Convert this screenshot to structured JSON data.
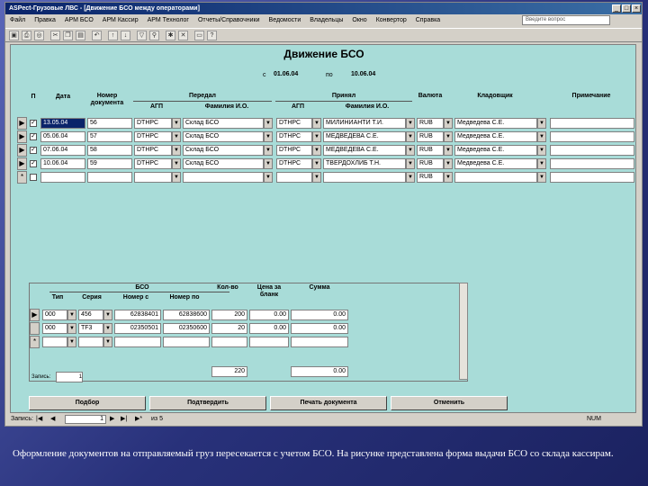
{
  "window": {
    "title": "ASPect-Грузовые ЛВС - [Движение БСО между операторами]",
    "minimize": "_",
    "maximize": "□",
    "close": "×"
  },
  "menu": [
    "Файл",
    "Правка",
    "АРМ БСО",
    "АРМ Кассир",
    "АРМ Технолог",
    "Отчеты/Справочники",
    "Ведомости",
    "Владельцы",
    "Окно",
    "Конвертор",
    "Справка"
  ],
  "help_placeholder": "Введите вопрос",
  "toolbar": {
    "icons": [
      "save",
      "print",
      "preview",
      "cut",
      "copy",
      "paste",
      "undo",
      "sort-asc",
      "sort-desc",
      "filter",
      "find",
      "new",
      "delete",
      "close",
      "help"
    ]
  },
  "form": {
    "title": "Движение БСО",
    "period": {
      "from_label": "с",
      "from": "01.06.04",
      "to_label": "по",
      "to": "10.06.04"
    },
    "headers": {
      "p": "П",
      "date": "Дата",
      "docnum": "Номер документа",
      "transfer": "Передал",
      "recv": "Принял",
      "agp": "АГП",
      "fio": "Фамилия И.О.",
      "agp2": "АГП",
      "fio2": "Фамилия И.О.",
      "currency": "Валюта",
      "storekeeper": "Кладовщик",
      "note": "Примечание"
    },
    "rows": [
      {
        "sel": "▶",
        "date": "13.05.04",
        "num": "56",
        "agp": "DTHPC",
        "fio": "Склад БСО",
        "agp2": "DTHPC",
        "fio2": "МИЛИНИАНТИ Т.И.",
        "cur": "RUB",
        "keeper": "Медведева С.Е."
      },
      {
        "sel": "▶",
        "date": "05.06.04",
        "num": "57",
        "agp": "DTHPC",
        "fio": "Склад БСО",
        "agp2": "DTHPC",
        "fio2": "МЕДВЕДЕВА С.Е.",
        "cur": "RUB",
        "keeper": "Медведева С.Е."
      },
      {
        "sel": "▶",
        "date": "07.06.04",
        "num": "58",
        "agp": "DTHPC",
        "fio": "Склад БСО",
        "agp2": "DTHPC",
        "fio2": "МЕДВЕДЕВА С.Е.",
        "cur": "RUB",
        "keeper": "Медведева С.Е."
      },
      {
        "sel": "▶",
        "date": "10.06.04",
        "num": "59",
        "agp": "DTHPC",
        "fio": "Склад БСО",
        "agp2": "DTHPC",
        "fio2": "ТВЕРДОХЛИБ Т.Н.",
        "cur": "RUB",
        "keeper": "Медведева С.Е."
      },
      {
        "sel": "*",
        "date": "",
        "num": "",
        "agp": "",
        "fio": "",
        "agp2": "",
        "fio2": "",
        "cur": "RUB",
        "keeper": ""
      }
    ],
    "sub": {
      "headers": {
        "bso": "БСО",
        "type": "Тип",
        "series": "Серия",
        "from": "Номер с",
        "to": "Номер по",
        "count": "Кол-во",
        "price": "Цена за бланк",
        "sum": "Сумма"
      },
      "rows": [
        {
          "type": "000",
          "series": "456",
          "from": "62838401",
          "to": "62838600",
          "count": "200",
          "price": "0.00",
          "sum": "0.00"
        },
        {
          "type": "000",
          "series": "TF3",
          "from": "02350501",
          "to": "02350600",
          "count": "20",
          "price": "0.00",
          "sum": "0.00"
        },
        {
          "type": "",
          "series": "",
          "from": "",
          "to": "",
          "count": "",
          "price": "",
          "sum": ""
        }
      ],
      "record_label": "Запись:",
      "record_num": "1",
      "total_count": "220",
      "total_sum": "0.00"
    },
    "buttons": {
      "select": "Подбор",
      "confirm": "Подтвердить",
      "print": "Печать документа",
      "cancel": "Отменить"
    }
  },
  "navigator": {
    "label": "Запись:",
    "current": "1",
    "of": "из 5"
  },
  "statusbar": {
    "num": "NUM"
  },
  "caption": "Оформление документов на отправляемый груз пересекается с учетом БСО. На рисунке представлена форма выдачи БСО со склада кассирам."
}
